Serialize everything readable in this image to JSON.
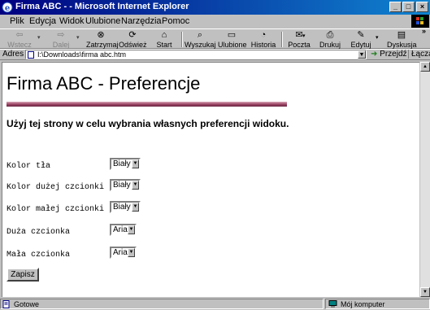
{
  "window": {
    "title": "Firma ABC - - Microsoft Internet Explorer",
    "controls": {
      "minimize": "_",
      "maximize": "□",
      "close": "×"
    }
  },
  "menu": {
    "items": [
      "Plik",
      "Edycja",
      "Widok",
      "Ulubione",
      "Narzędzia",
      "Pomoc"
    ]
  },
  "toolbar": {
    "back": "Wstecz",
    "forward": "Dalej",
    "stop": "Zatrzymaj",
    "refresh": "Odśwież",
    "home": "Start",
    "search": "Wyszukaj",
    "favorites": "Ulubione",
    "history": "Historia",
    "mail": "Poczta",
    "print": "Drukuj",
    "edit": "Edytuj",
    "discuss": "Dyskusja"
  },
  "address": {
    "label": "Adres",
    "value": "I:\\Downloads\\firma abc.htm",
    "go": "Przejdź",
    "links": "Łącza"
  },
  "page": {
    "heading": "Firma ABC - Preferencje",
    "subtitle": "Użyj tej strony w celu wybrania własnych preferencji widoku.",
    "preferences": [
      {
        "label": "Kolor tła",
        "value": "Biały"
      },
      {
        "label": "Kolor dużej czcionki",
        "value": "Biały"
      },
      {
        "label": "Kolor małej czcionki",
        "value": "Biały"
      },
      {
        "label": "Duża czcionka",
        "value": "Arial"
      },
      {
        "label": "Mała czcionka",
        "value": "Arial"
      }
    ],
    "save_label": "Zapisz",
    "rule_color": "#a04868"
  },
  "status": {
    "text": "Gotowe",
    "zone": "Mój komputer"
  }
}
